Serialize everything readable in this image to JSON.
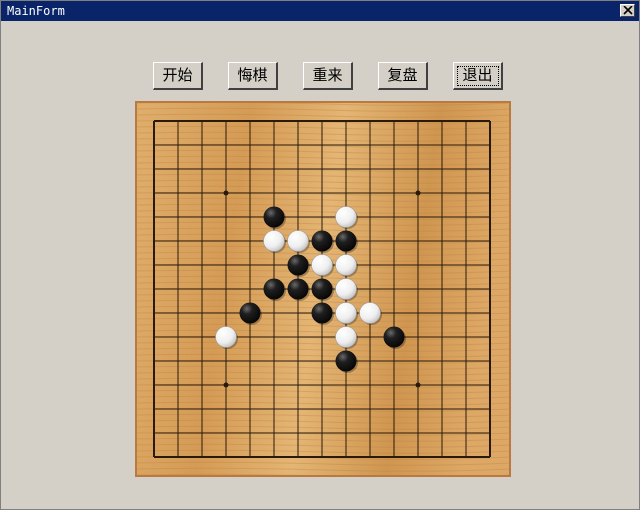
{
  "window": {
    "title": "MainForm"
  },
  "toolbar": {
    "buttons": [
      {
        "id": "start",
        "label": "开始"
      },
      {
        "id": "undo",
        "label": "悔棋"
      },
      {
        "id": "restart",
        "label": "重来"
      },
      {
        "id": "replay",
        "label": "复盘"
      },
      {
        "id": "exit",
        "label": "退出"
      }
    ]
  },
  "board": {
    "size": 15,
    "star_points": [
      [
        3,
        3
      ],
      [
        11,
        3
      ],
      [
        3,
        11
      ],
      [
        11,
        11
      ]
    ],
    "colors": {
      "wood": "#d9a45f",
      "line": "#2a1a0a",
      "black_stone": "#151515",
      "white_stone": "#f2f2f2"
    },
    "stones": [
      {
        "col": 5,
        "row": 4,
        "color": "black"
      },
      {
        "col": 8,
        "row": 4,
        "color": "white"
      },
      {
        "col": 5,
        "row": 5,
        "color": "white"
      },
      {
        "col": 6,
        "row": 5,
        "color": "white"
      },
      {
        "col": 7,
        "row": 5,
        "color": "black"
      },
      {
        "col": 8,
        "row": 5,
        "color": "black"
      },
      {
        "col": 6,
        "row": 6,
        "color": "black"
      },
      {
        "col": 7,
        "row": 6,
        "color": "white"
      },
      {
        "col": 8,
        "row": 6,
        "color": "white"
      },
      {
        "col": 5,
        "row": 7,
        "color": "black"
      },
      {
        "col": 6,
        "row": 7,
        "color": "black"
      },
      {
        "col": 7,
        "row": 7,
        "color": "black"
      },
      {
        "col": 8,
        "row": 7,
        "color": "white"
      },
      {
        "col": 4,
        "row": 8,
        "color": "black"
      },
      {
        "col": 7,
        "row": 8,
        "color": "black"
      },
      {
        "col": 8,
        "row": 8,
        "color": "white"
      },
      {
        "col": 9,
        "row": 8,
        "color": "white"
      },
      {
        "col": 3,
        "row": 9,
        "color": "white"
      },
      {
        "col": 8,
        "row": 9,
        "color": "white"
      },
      {
        "col": 10,
        "row": 9,
        "color": "black"
      },
      {
        "col": 8,
        "row": 10,
        "color": "black"
      }
    ]
  }
}
